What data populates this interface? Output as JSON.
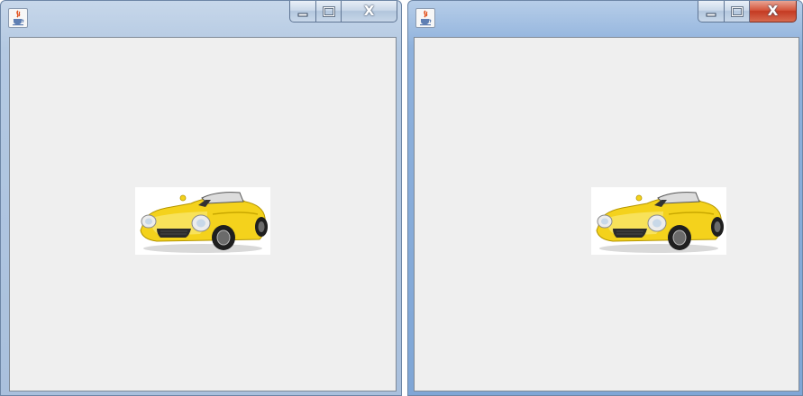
{
  "windows": [
    {
      "id": "left",
      "title": "",
      "app_icon": "java-icon",
      "buttons": {
        "minimize": "minimize-icon",
        "maximize": "maximize-icon",
        "close": "close-icon"
      },
      "content": {
        "image": "yellow-convertible-car-image"
      }
    },
    {
      "id": "right",
      "title": "",
      "app_icon": "java-icon",
      "buttons": {
        "minimize": "minimize-icon",
        "maximize": "maximize-icon",
        "close": "close-icon"
      },
      "content": {
        "image": "yellow-convertible-car-image"
      }
    }
  ],
  "colors": {
    "client_background": "#efefef",
    "car_body": "#f4d21c",
    "close_active": "#c43a22"
  }
}
